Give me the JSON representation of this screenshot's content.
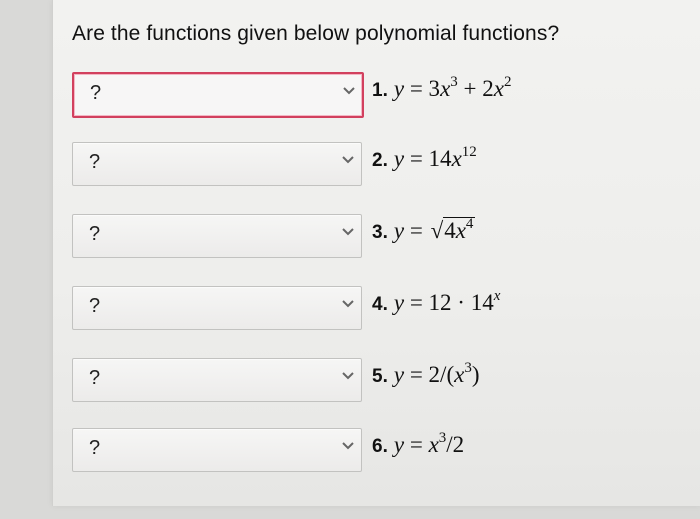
{
  "question": "Are the functions given below polynomial functions?",
  "select_placeholder": "?",
  "items": [
    {
      "num": "1.",
      "state": "invalid"
    },
    {
      "num": "2."
    },
    {
      "num": "3."
    },
    {
      "num": "4."
    },
    {
      "num": "5."
    },
    {
      "num": "6."
    }
  ],
  "colors": {
    "invalid_border": "#d2405e",
    "background": "#eeeeec"
  },
  "icons": {
    "dropdown": "chevron-down-icon"
  }
}
